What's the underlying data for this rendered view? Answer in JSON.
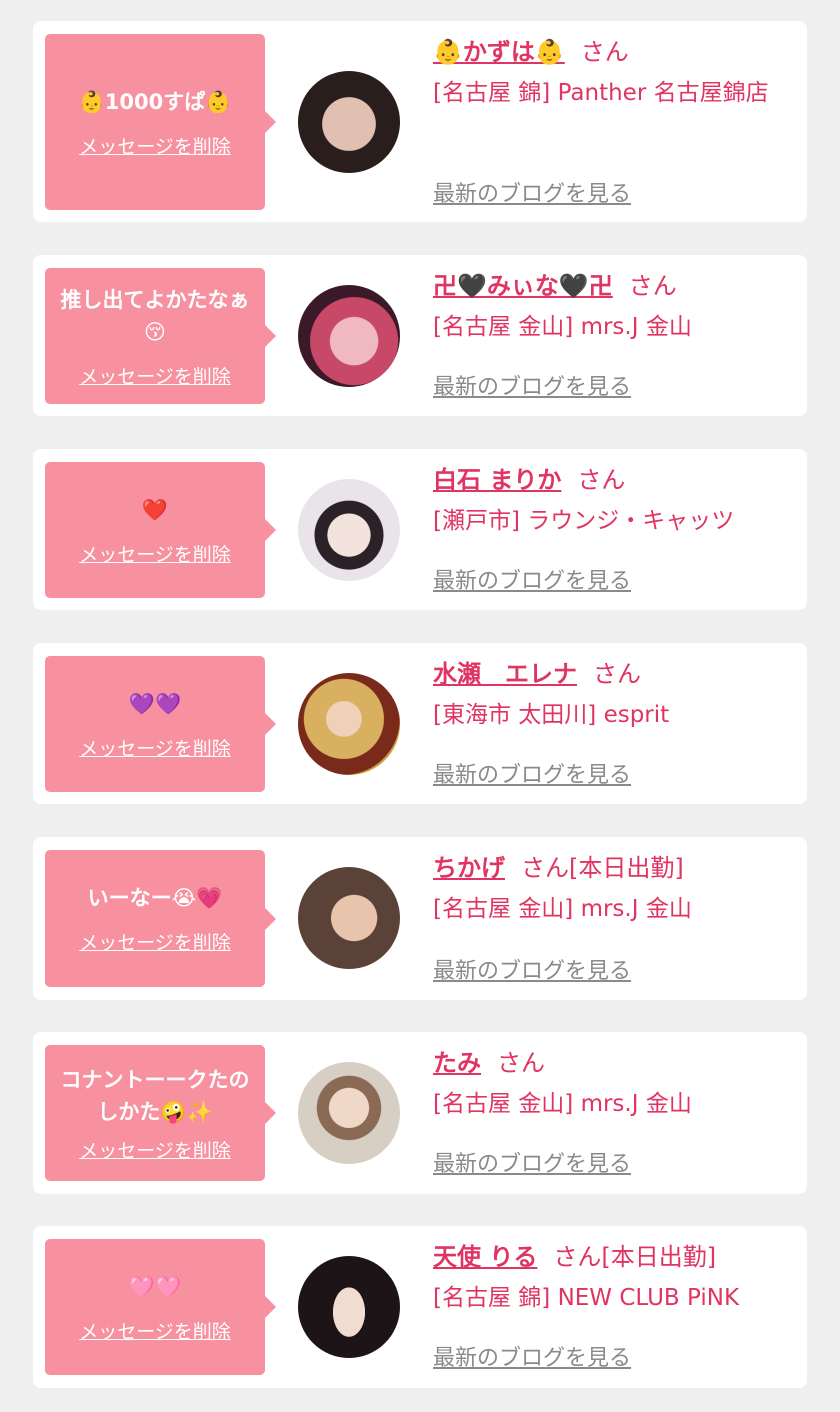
{
  "items": [
    {
      "message": "👶1000すぱ👶",
      "delete_label": "メッセージを削除",
      "name": "👶かずは👶",
      "honorific": "さん",
      "status": "",
      "shop": "[名古屋 錦] Panther 名古屋錦店",
      "blog_label": "最新のブログを見る",
      "avatar_colors": [
        "#2a1e1c",
        "#d8b8a8"
      ]
    },
    {
      "message": "推し出てよかたなぁ😚",
      "delete_label": "メッセージを削除",
      "name": "卍🖤みぃな🖤卍",
      "honorific": "さん",
      "status": "",
      "shop": "[名古屋 金山] mrs.J 金山",
      "blog_label": "最新のブログを見る",
      "avatar_colors": [
        "#3a1a28",
        "#d85878"
      ]
    },
    {
      "message": "❤️",
      "delete_label": "メッセージを削除",
      "name": "白石 まりか",
      "honorific": "さん",
      "status": "",
      "shop": "[瀬戸市] ラウンジ・キャッツ",
      "blog_label": "最新のブログを見る",
      "avatar_colors": [
        "#e8e4ea",
        "#2a2226"
      ]
    },
    {
      "message": "💜💜",
      "delete_label": "メッセージを削除",
      "name": "水瀬　エレナ",
      "honorific": "さん",
      "status": "",
      "shop": "[東海市 太田川] esprit",
      "blog_label": "最新のブログを見る",
      "avatar_colors": [
        "#c8a040",
        "#7a2a1a"
      ]
    },
    {
      "message": "いーなー😭💗",
      "delete_label": "メッセージを削除",
      "name": "ちかげ",
      "honorific": "さん",
      "status": "[本日出勤]",
      "shop": "[名古屋 金山] mrs.J 金山",
      "blog_label": "最新のブログを見る",
      "avatar_colors": [
        "#5a4238",
        "#dcb49c"
      ]
    },
    {
      "message": "コナントーークたのしかた🤪✨",
      "delete_label": "メッセージを削除",
      "name": "たみ",
      "honorific": "さん",
      "status": "",
      "shop": "[名古屋 金山] mrs.J 金山",
      "blog_label": "最新のブログを見る",
      "avatar_colors": [
        "#d8cfc4",
        "#8a6a54"
      ]
    },
    {
      "message": "🩷🩷",
      "delete_label": "メッセージを削除",
      "name": "天使 りる",
      "honorific": "さん",
      "status": "[本日出勤]",
      "shop": "[名古屋 錦] NEW CLUB PiNK",
      "blog_label": "最新のブログを見る",
      "avatar_colors": [
        "#ffffff",
        "#1c1416"
      ]
    }
  ]
}
